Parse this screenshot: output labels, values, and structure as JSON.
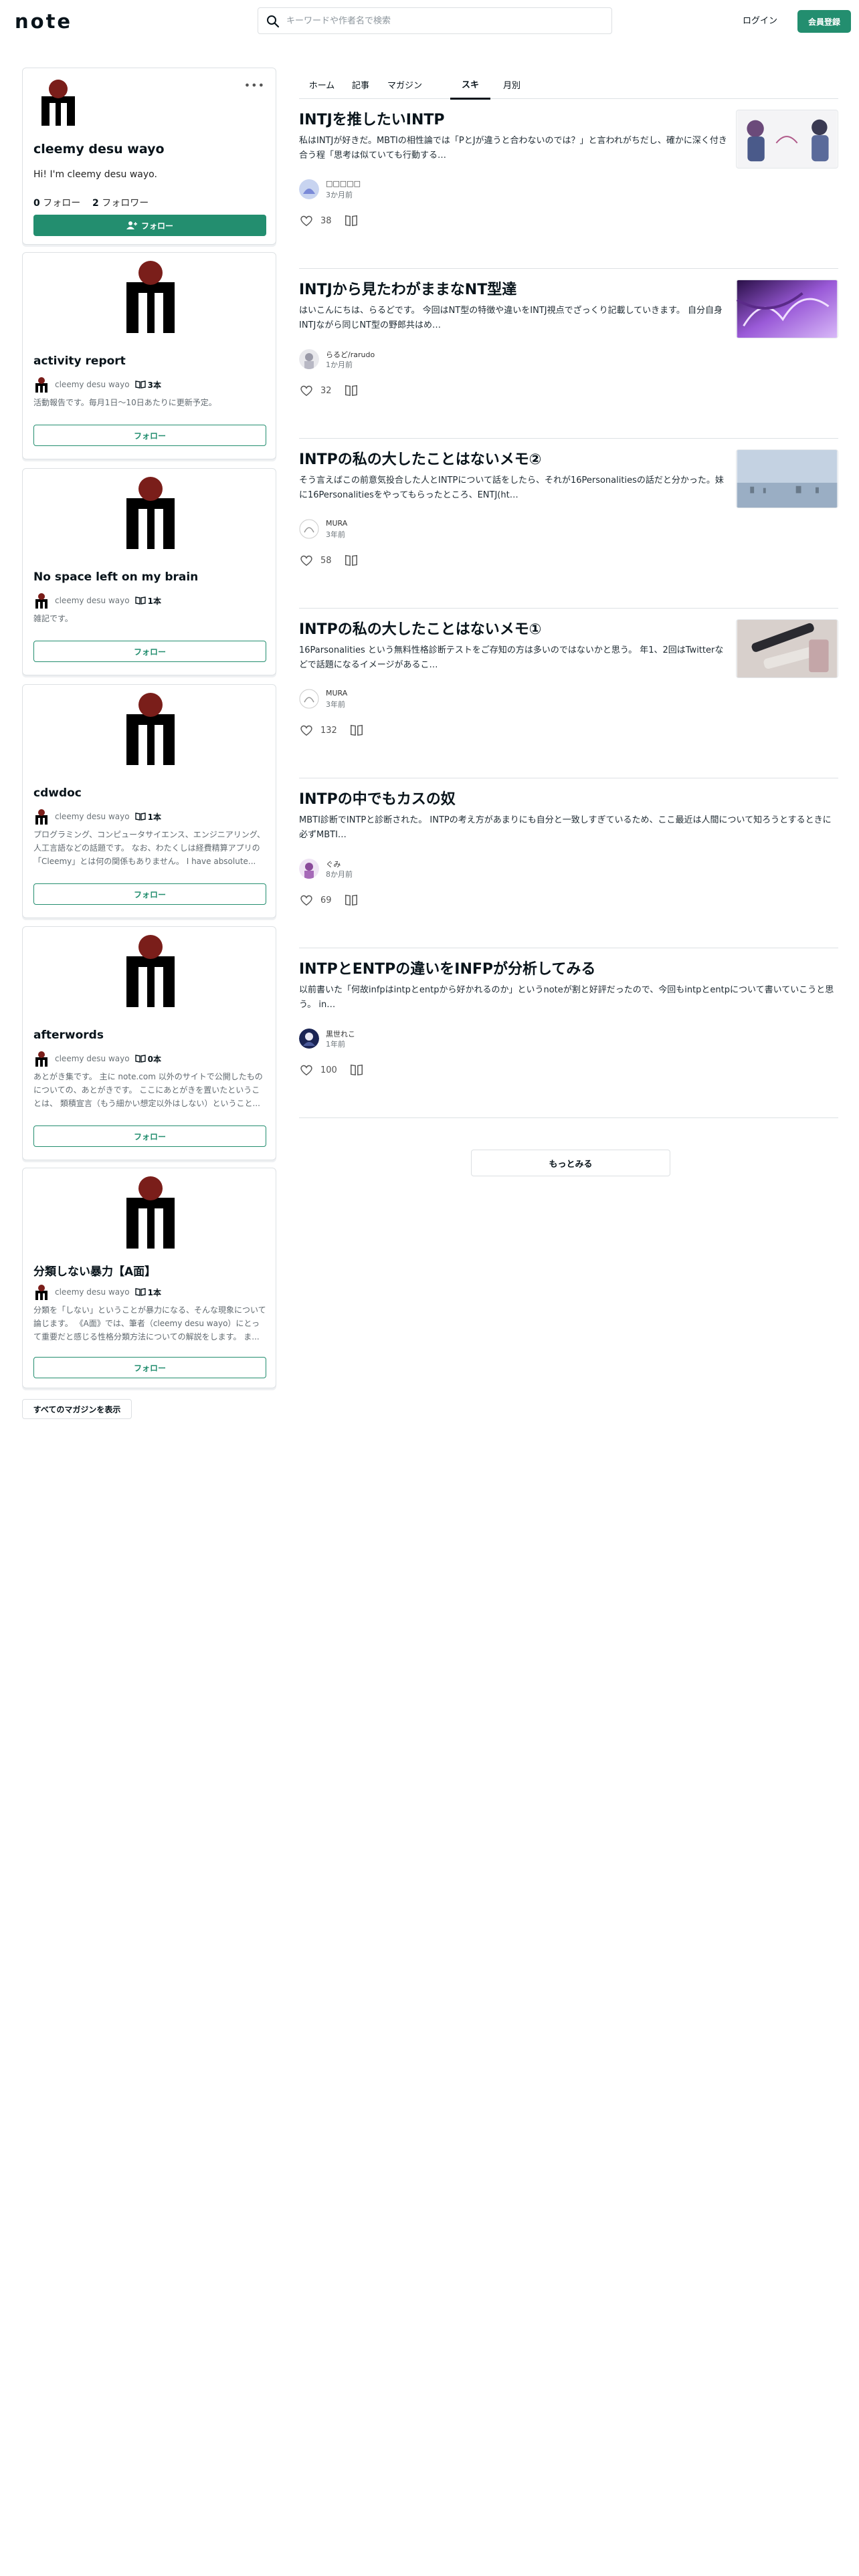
{
  "header": {
    "logo_text": "note",
    "search_placeholder": "キーワードや作者名で検索",
    "login_label": "ログイン",
    "signup_label": "会員登録"
  },
  "profile": {
    "name": "cleemy desu wayo",
    "bio": "Hi! I'm cleemy desu wayo.",
    "follow_count": "0",
    "follow_label": "フォロー",
    "follower_count": "2",
    "follower_label": "フォロワー",
    "follow_button": "フォロー",
    "more_icon": "more-dots-icon"
  },
  "magazines": [
    {
      "title": "activity report",
      "author": "cleemy desu wayo",
      "count": "3本",
      "desc": "活動報告です。毎月1日〜10日あたりに更新予定。",
      "follow": "フォロー"
    },
    {
      "title": "No space left on my brain",
      "author": "cleemy desu wayo",
      "count": "1本",
      "desc": "雑記です。",
      "follow": "フォロー"
    },
    {
      "title": "cdwdoc",
      "author": "cleemy desu wayo",
      "count": "1本",
      "desc": "プログラミング、コンピュータサイエンス、エンジニアリング、人工言語などの話題です。 なお、わたくしは経費精算アプリの「Cleemy」とは何の関係もありません。 I have absolute...",
      "follow": "フォロー"
    },
    {
      "title": "afterwords",
      "author": "cleemy desu wayo",
      "count": "0本",
      "desc": "あとがき集です。 主に note.com 以外のサイトで公開したものについての、あとがきです。 ここにあとがきを置いたということは、 類積宣言（もう細かい想定以外はしない）ということ...",
      "follow": "フォロー"
    },
    {
      "title": "分類しない暴力【A面】",
      "author": "cleemy desu wayo",
      "count": "1本",
      "desc": "分類を「しない」ということが暴力になる、そんな現象について論じます。 《A面》では、筆者（cleemy desu wayo）にとって重要だと感じる性格分類方法についての解説をします。 ま...",
      "follow": "フォロー"
    }
  ],
  "all_magazines_label": "すべてのマガジンを表示",
  "tabs": [
    "ホーム",
    "記事",
    "マガジン",
    "スキ",
    "月別"
  ],
  "active_tab": "スキ",
  "articles": [
    {
      "title": "INTJを推したいINTP",
      "excerpt": "私はINTJが好きだ。MBTIの相性論では「PとJが違うと合わないのでは？」と言われがちだし、確かに深く付き合う程「思考は似ていても行動する…",
      "author": "□□□□□",
      "time": "3か月前",
      "likes": "38"
    },
    {
      "title": "INTJから見たわがままなNT型達",
      "excerpt": "はいこんにちは、らるどです。 今回はNT型の特徴や違いをINTJ視点でざっくり記載していきます。 自分自身INTJながら同じNT型の野郎共はめ…",
      "author": "らるど/rarudo",
      "time": "1か月前",
      "likes": "32"
    },
    {
      "title": "INTPの私の大したことはないメモ②",
      "excerpt": "そう言えばこの前意気投合した人とINTPについて話をしたら、それが16Personalitiesの話だと分かった。妹に16Personalitiesをやってもらったところ、ENTJ(ht…",
      "author": "MURA",
      "time": "3年前",
      "likes": "58"
    },
    {
      "title": "INTPの私の大したことはないメモ①",
      "excerpt": "16Parsonalities という無料性格診断テストをご存知の方は多いのではないかと思う。 年1、2回はTwitterなどで話題になるイメージがあるこ…",
      "author": "MURA",
      "time": "3年前",
      "likes": "132"
    },
    {
      "title": "INTPの中でもカスの奴",
      "excerpt": "MBTI診断でINTPと診断された。 INTPの考え方があまりにも自分と一致しすぎているため、ここ最近は人間について知ろうとするときに必ずMBTI…",
      "author": "ぐみ",
      "time": "8か月前",
      "likes": "69"
    },
    {
      "title": "INTPとENTPの違いをINFPが分析してみる",
      "excerpt": "以前書いた「何故infpはintpとentpから好かれるのか」というnoteが割と好評だったので、今回もintpとentpについて書いていこうと思う。 in…",
      "author": "黒世れこ",
      "time": "1年前",
      "likes": "100"
    }
  ],
  "more_label": "もっとみる",
  "colors": {
    "accent": "#238e6f",
    "border": "#dde1e4",
    "logo_red": "#7a1e1a"
  }
}
